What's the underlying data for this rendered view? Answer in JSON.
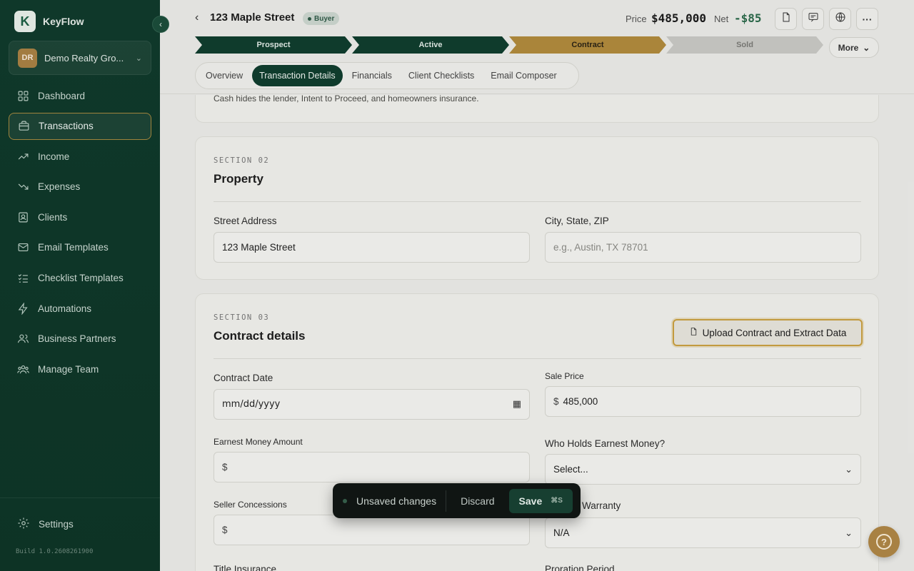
{
  "app": {
    "name": "KeyFlow",
    "logo_letter": "K"
  },
  "org": {
    "initials": "DR",
    "name": "Demo Realty Gro..."
  },
  "sidebar": {
    "items": [
      {
        "label": "Dashboard",
        "icon": "dashboard-icon"
      },
      {
        "label": "Transactions",
        "icon": "briefcase-icon"
      },
      {
        "label": "Income",
        "icon": "trending-up-icon"
      },
      {
        "label": "Expenses",
        "icon": "trending-down-icon"
      },
      {
        "label": "Clients",
        "icon": "contacts-icon"
      },
      {
        "label": "Email Templates",
        "icon": "mail-icon"
      },
      {
        "label": "Checklist Templates",
        "icon": "checklist-icon"
      },
      {
        "label": "Automations",
        "icon": "bolt-icon"
      },
      {
        "label": "Business Partners",
        "icon": "partners-icon"
      },
      {
        "label": "Manage Team",
        "icon": "team-icon"
      }
    ],
    "active_index": 1,
    "settings_label": "Settings",
    "build": "Build 1.0.2608261900"
  },
  "header": {
    "title": "123 Maple Street",
    "badge": "Buyer",
    "price_label": "Price",
    "price_value": "$485,000",
    "net_label": "Net",
    "net_value": "-$85",
    "more_label": "More"
  },
  "stages": [
    {
      "label": "Prospect",
      "state": "done"
    },
    {
      "label": "Active",
      "state": "done"
    },
    {
      "label": "Contract",
      "state": "current"
    },
    {
      "label": "Sold",
      "state": "future"
    }
  ],
  "tabs": [
    "Overview",
    "Transaction Details",
    "Financials",
    "Client Checklists",
    "Email Composer"
  ],
  "active_tab": 1,
  "section1": {
    "note": "Cash hides the lender, Intent to Proceed, and homeowners insurance."
  },
  "section2": {
    "label": "SECTION 02",
    "title": "Property",
    "street_label": "Street Address",
    "street_value": "123 Maple Street",
    "city_label": "City, State, ZIP",
    "city_placeholder": "e.g., Austin, TX 78701"
  },
  "section3": {
    "label": "SECTION 03",
    "title": "Contract details",
    "upload_label": "Upload Contract and Extract Data",
    "contract_date_label": "Contract Date",
    "contract_date_value": "mm/dd/yyyy",
    "sale_price_label": "Sale Price",
    "sale_price_prefix": "$",
    "sale_price_value": "485,000",
    "earnest_label": "Earnest Money Amount",
    "earnest_prefix": "$",
    "holder_label": "Who Holds Earnest Money?",
    "holder_value": "Select...",
    "concessions_label": "Seller Concessions",
    "concessions_prefix": "$",
    "warranty_label": "Warranty",
    "warranty_value": "N/A",
    "title_ins_label": "Title Insurance",
    "proration_label": "Proration Period"
  },
  "unsaved": {
    "text": "Unsaved changes",
    "discard": "Discard",
    "save": "Save",
    "shortcut": "⌘S"
  },
  "help": {
    "glyph": "?"
  }
}
